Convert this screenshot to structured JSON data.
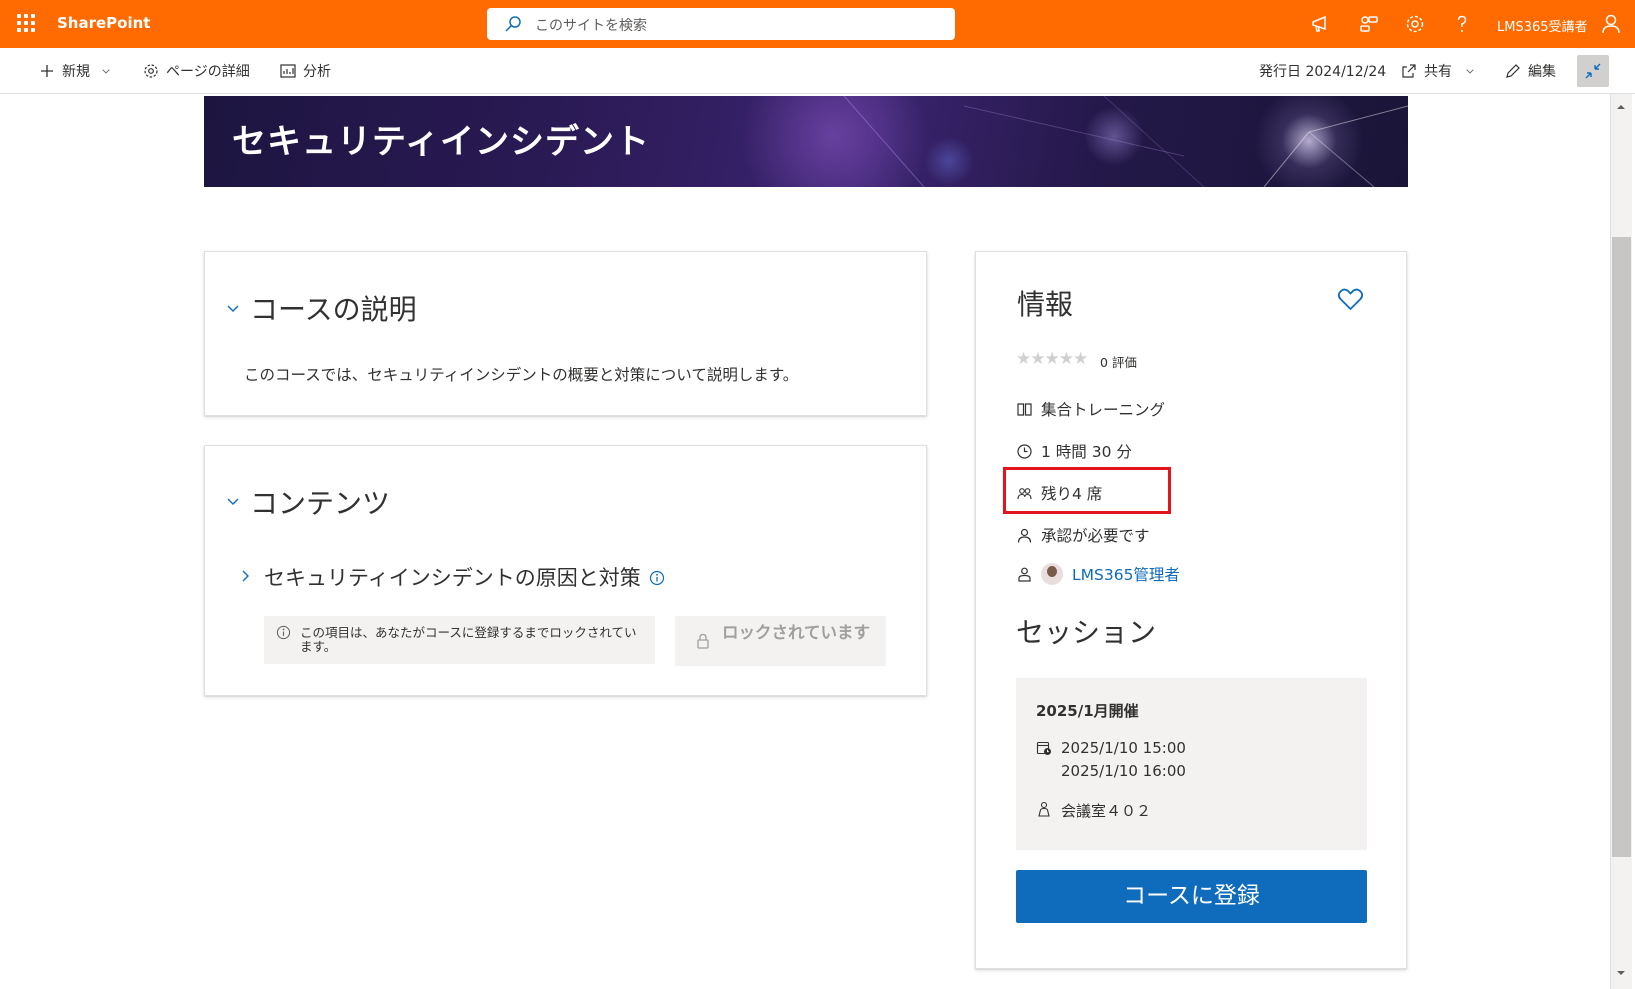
{
  "suitebar": {
    "brand": "SharePoint",
    "search_placeholder": "このサイトを検索",
    "user": "LMS365受講者"
  },
  "commandbar": {
    "new_label": "新規",
    "page_details_label": "ページの詳細",
    "analytics_label": "分析",
    "published": "発行日 2024/12/24",
    "share_label": "共有",
    "edit_label": "編集"
  },
  "banner": {
    "title": "セキュリティインシデント"
  },
  "description": {
    "title": "コースの説明",
    "text": "このコースでは、セキュリティインシデントの概要と対策について説明します。"
  },
  "contents": {
    "title": "コンテンツ",
    "item_title": "セキュリティインシデントの原因と対策",
    "lock_note": "この項目は、あなたがコースに登録するまでロックされています。",
    "lock_button": "ロックされています"
  },
  "info": {
    "title": "情報",
    "stars": "★★★★★",
    "rating_count": "0 評価",
    "rating_value": 0,
    "training_type": "集合トレーニング",
    "duration": "1 時間 30 分",
    "seats": "残り4 席",
    "approval": "承認が必要です",
    "owner": "LMS365管理者"
  },
  "session": {
    "title": "セッション",
    "name": "2025/1月開催",
    "start": "2025/1/10 15:00",
    "end": "2025/1/10 16:00",
    "location": "会議室４０２"
  },
  "register_button": "コースに登録",
  "colors": {
    "suitebar": "#ff6b00",
    "accent": "#0f6cbd",
    "highlight": "#e3151a"
  }
}
